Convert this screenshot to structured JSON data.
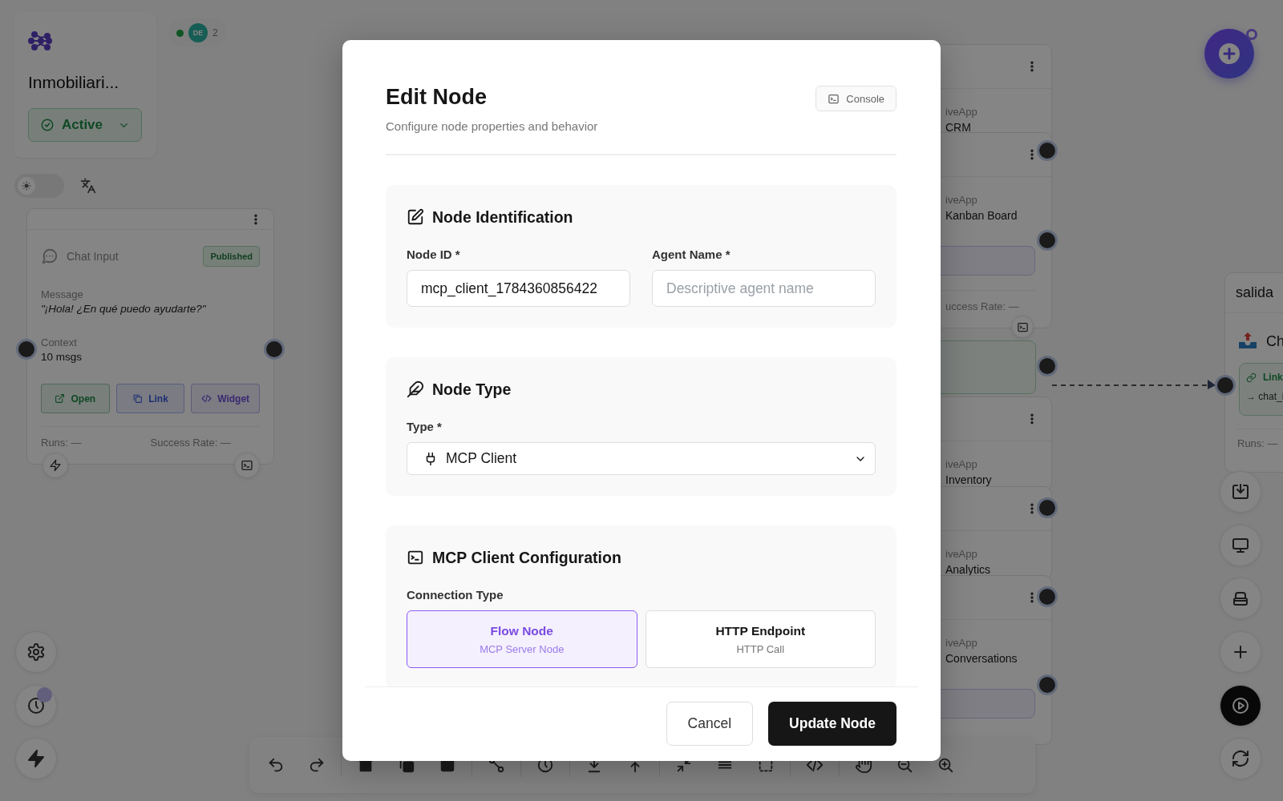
{
  "project": {
    "title": "Inmobiliari...",
    "status": "Active"
  },
  "presence": {
    "online": true,
    "initials": "DE",
    "count": "2"
  },
  "theme_toggle": {
    "on": false
  },
  "chat_node": {
    "title": "Chat Input",
    "badge": "Published",
    "fields": [
      {
        "kind": "quote",
        "label": "Message",
        "value": "\"¡Hola! ¿En qué puedo ayudarte?\""
      },
      {
        "kind": "count",
        "label": "Context",
        "value": "10 msgs"
      }
    ],
    "actions": [
      {
        "kind": "open",
        "label": "Open"
      },
      {
        "kind": "link",
        "label": "Link"
      },
      {
        "kind": "widget",
        "label": "Widget"
      }
    ],
    "runs": "Runs: —",
    "success_rate": "Success Rate: —"
  },
  "app_nodes": [
    {
      "app": "iveApp",
      "name": "CRM"
    },
    {
      "app": "iveApp",
      "name": "Kanban Board",
      "stats": "uccess Rate: —"
    },
    {
      "app": "iveApp",
      "name": "Inventory"
    },
    {
      "app": "iveApp",
      "name": "Analytics"
    },
    {
      "app": "iveApp",
      "name": "Conversations"
    }
  ],
  "output_node": {
    "title": "salida",
    "item": "Ch",
    "link": "Link",
    "target": "→ chat_i",
    "runs": "Runs: —"
  },
  "modal": {
    "title": "Edit Node",
    "subtitle": "Configure node properties and behavior",
    "console_button": "Console",
    "sections": [
      {
        "kind": "identification",
        "title": "Node Identification",
        "fields": [
          {
            "label": "Node ID *",
            "value": "mcp_client_1784360856422"
          },
          {
            "label": "Agent Name *",
            "placeholder": "Descriptive agent name"
          }
        ]
      },
      {
        "kind": "type",
        "title": "Node Type",
        "fields": [
          {
            "label": "Type *",
            "value": "MCP Client"
          }
        ]
      },
      {
        "kind": "config",
        "title": "MCP Client Configuration",
        "label": "Connection Type",
        "options": [
          {
            "title": "Flow Node",
            "subtitle": "MCP Server Node",
            "selected": true
          },
          {
            "title": "HTTP Endpoint",
            "subtitle": "HTTP Call",
            "selected": false
          }
        ]
      }
    ],
    "buttons": [
      {
        "kind": "cancel",
        "label": "Cancel"
      },
      {
        "kind": "submit",
        "label": "Update Node"
      }
    ]
  }
}
